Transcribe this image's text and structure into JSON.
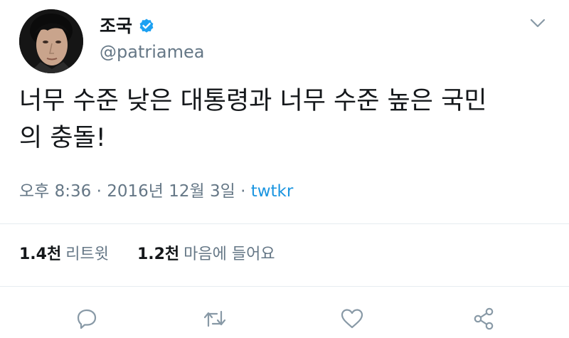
{
  "tweet": {
    "author": {
      "display_name": "조국",
      "handle": "@patriamea",
      "verified_icon": "verified-badge-icon"
    },
    "text_line1": "너무 수준 낮은 대통령과 너무 수준 높은 국민",
    "text_line2": "의 충돌!",
    "time": "오후 8:36",
    "separator": "·",
    "date": "2016년 12월 3일",
    "source": "twtkr",
    "retweets": {
      "count": "1.4천",
      "label": "리트윗"
    },
    "likes": {
      "count": "1.2천",
      "label": "마음에 들어요"
    },
    "actions": [
      {
        "name": "reply",
        "icon": "reply-icon"
      },
      {
        "name": "retweet",
        "icon": "retweet-icon"
      },
      {
        "name": "like",
        "icon": "heart-icon"
      },
      {
        "name": "share",
        "icon": "share-icon"
      }
    ]
  },
  "colors": {
    "text": "#14171a",
    "secondary": "#657786",
    "link": "#1b95e0",
    "verified": "#1da1f2",
    "divider": "#e6ecf0"
  }
}
